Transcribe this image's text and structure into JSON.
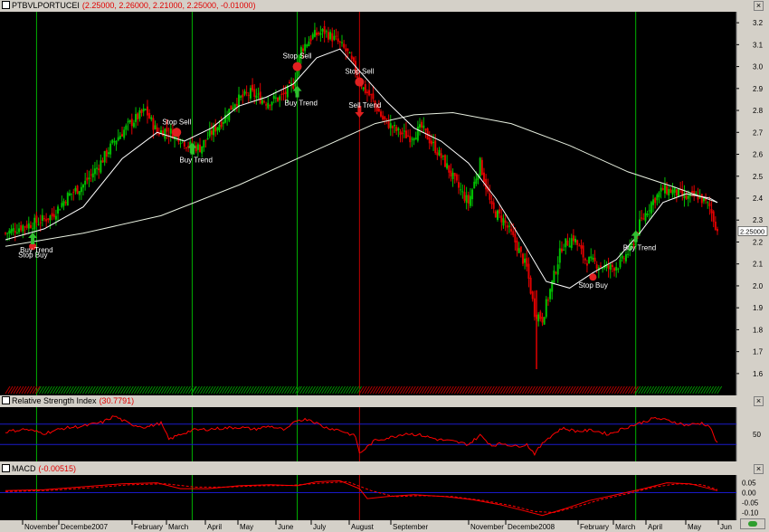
{
  "main_pane": {
    "symbol": "PTBVLPORTUCEI",
    "ohlc_text": "(2.25000, 2.26000, 2.21000, 2.25000, -0.01000)",
    "last_price_label": "2.25000",
    "y_ticks": [
      "3.2",
      "3.1",
      "3.0",
      "2.9",
      "2.8",
      "2.7",
      "2.6",
      "2.5",
      "2.4",
      "2.3",
      "2.2",
      "2.1",
      "2.0",
      "1.9",
      "1.8",
      "1.7",
      "1.6"
    ]
  },
  "rsi_pane": {
    "name": "Relative Strength Index",
    "value_text": "(30.7791)",
    "y_ticks": [
      "50"
    ]
  },
  "macd_pane": {
    "name": "MACD",
    "value_text": "(-0.00515)",
    "y_ticks": [
      "0.05",
      "0.00",
      "-0.05",
      "-0.10"
    ]
  },
  "x_axis_labels": [
    "November",
    "Decembe2007",
    "February",
    "March",
    "April",
    "May",
    "June",
    "July",
    "August",
    "September",
    "November",
    "Decembe2008",
    "February",
    "March",
    "April",
    "May",
    "Jun"
  ],
  "annotations": {
    "stop_buy": "Stop Buy",
    "buy_trend": "Buy Trend",
    "stop_sell": "Stop Sell",
    "sell_trend": "Sell Trend"
  },
  "colors": {
    "background": "#000000",
    "candle_up": "#00c000",
    "candle_down": "#e00000",
    "ma_fast": "#ffffff",
    "ma_slow": "#e8f0e0",
    "buy_line": "#00b000",
    "sell_line": "#c00000",
    "rsi_line": "#ff0000",
    "guide_line": "#1a1ac8"
  },
  "chart_data": [
    {
      "type": "candlestick",
      "title": "PTBVLPORTUCEI",
      "ylim": [
        1.55,
        3.25
      ],
      "y_ticks": [
        3.2,
        3.1,
        3.0,
        2.9,
        2.8,
        2.7,
        2.6,
        2.5,
        2.4,
        2.3,
        2.2,
        2.1,
        2.0,
        1.9,
        1.8,
        1.7,
        1.6
      ],
      "close_path": [
        [
          0,
          2.24
        ],
        [
          8,
          2.27
        ],
        [
          16,
          2.29
        ],
        [
          24,
          2.32
        ],
        [
          32,
          2.41
        ],
        [
          40,
          2.46
        ],
        [
          48,
          2.55
        ],
        [
          56,
          2.66
        ],
        [
          64,
          2.74
        ],
        [
          72,
          2.8
        ],
        [
          78,
          2.7
        ],
        [
          82,
          2.71
        ],
        [
          88,
          2.69
        ],
        [
          94,
          2.64
        ],
        [
          100,
          2.63
        ],
        [
          106,
          2.7
        ],
        [
          112,
          2.76
        ],
        [
          118,
          2.84
        ],
        [
          126,
          2.88
        ],
        [
          134,
          2.84
        ],
        [
          142,
          2.86
        ],
        [
          148,
          2.92
        ],
        [
          152,
          3.08
        ],
        [
          158,
          3.14
        ],
        [
          164,
          3.16
        ],
        [
          170,
          3.12
        ],
        [
          176,
          3.06
        ],
        [
          180,
          2.98
        ],
        [
          184,
          2.9
        ],
        [
          188,
          2.86
        ],
        [
          194,
          2.76
        ],
        [
          202,
          2.7
        ],
        [
          208,
          2.68
        ],
        [
          214,
          2.72
        ],
        [
          220,
          2.64
        ],
        [
          226,
          2.56
        ],
        [
          232,
          2.46
        ],
        [
          238,
          2.38
        ],
        [
          244,
          2.56
        ],
        [
          250,
          2.35
        ],
        [
          256,
          2.3
        ],
        [
          262,
          2.2
        ],
        [
          268,
          2.08
        ],
        [
          272,
          1.88
        ],
        [
          276,
          1.85
        ],
        [
          280,
          1.98
        ],
        [
          286,
          2.18
        ],
        [
          292,
          2.22
        ],
        [
          298,
          2.12
        ],
        [
          304,
          2.1
        ],
        [
          310,
          2.08
        ],
        [
          316,
          2.1
        ],
        [
          322,
          2.18
        ],
        [
          326,
          2.28
        ],
        [
          332,
          2.38
        ],
        [
          338,
          2.44
        ],
        [
          344,
          2.43
        ],
        [
          350,
          2.4
        ],
        [
          356,
          2.41
        ],
        [
          362,
          2.36
        ],
        [
          366,
          2.25
        ]
      ],
      "ma_fast_path": [
        [
          0,
          2.21
        ],
        [
          20,
          2.26
        ],
        [
          40,
          2.36
        ],
        [
          60,
          2.58
        ],
        [
          78,
          2.7
        ],
        [
          92,
          2.66
        ],
        [
          106,
          2.72
        ],
        [
          120,
          2.82
        ],
        [
          134,
          2.86
        ],
        [
          148,
          2.92
        ],
        [
          160,
          3.04
        ],
        [
          172,
          3.08
        ],
        [
          184,
          2.96
        ],
        [
          196,
          2.84
        ],
        [
          210,
          2.72
        ],
        [
          224,
          2.66
        ],
        [
          238,
          2.56
        ],
        [
          252,
          2.4
        ],
        [
          266,
          2.2
        ],
        [
          278,
          2.02
        ],
        [
          290,
          1.99
        ],
        [
          302,
          2.06
        ],
        [
          314,
          2.12
        ],
        [
          326,
          2.24
        ],
        [
          338,
          2.38
        ],
        [
          350,
          2.42
        ],
        [
          362,
          2.4
        ],
        [
          366,
          2.38
        ]
      ],
      "ma_slow_path": [
        [
          0,
          2.18
        ],
        [
          40,
          2.24
        ],
        [
          80,
          2.32
        ],
        [
          120,
          2.46
        ],
        [
          160,
          2.62
        ],
        [
          190,
          2.74
        ],
        [
          210,
          2.78
        ],
        [
          230,
          2.79
        ],
        [
          260,
          2.74
        ],
        [
          290,
          2.64
        ],
        [
          320,
          2.52
        ],
        [
          344,
          2.45
        ],
        [
          366,
          2.38
        ]
      ],
      "signals": [
        {
          "label": "Stop Buy",
          "x": 14,
          "price": 2.18
        },
        {
          "label": "Buy Trend",
          "x": 14,
          "price": 2.21
        },
        {
          "label": "Stop Sell",
          "x": 88,
          "price": 2.7
        },
        {
          "label": "Buy Trend",
          "x": 96,
          "price": 2.62
        },
        {
          "label": "Stop Sell",
          "x": 150,
          "price": 3.0
        },
        {
          "label": "Buy Trend",
          "x": 150,
          "price": 2.88
        },
        {
          "label": "Stop Sell",
          "x": 182,
          "price": 2.93
        },
        {
          "label": "Sell Trend",
          "x": 182,
          "price": 2.8
        },
        {
          "label": "Stop Buy",
          "x": 302,
          "price": 2.04
        },
        {
          "label": "Buy Trend",
          "x": 324,
          "price": 2.22
        }
      ],
      "buy_lines_x": [
        16,
        96,
        150,
        324
      ],
      "sell_lines_x": [
        182
      ]
    },
    {
      "type": "line",
      "title": "Relative Strength Index",
      "ylim": [
        0,
        100
      ],
      "guides": [
        70,
        30
      ],
      "value_path": [
        [
          0,
          55
        ],
        [
          10,
          60
        ],
        [
          20,
          52
        ],
        [
          30,
          62
        ],
        [
          40,
          66
        ],
        [
          50,
          74
        ],
        [
          56,
          86
        ],
        [
          64,
          70
        ],
        [
          72,
          64
        ],
        [
          80,
          72
        ],
        [
          84,
          40
        ],
        [
          90,
          50
        ],
        [
          96,
          58
        ],
        [
          104,
          60
        ],
        [
          112,
          62
        ],
        [
          120,
          64
        ],
        [
          128,
          60
        ],
        [
          136,
          66
        ],
        [
          144,
          58
        ],
        [
          150,
          78
        ],
        [
          156,
          80
        ],
        [
          164,
          64
        ],
        [
          172,
          58
        ],
        [
          180,
          46
        ],
        [
          182,
          12
        ],
        [
          190,
          38
        ],
        [
          198,
          44
        ],
        [
          206,
          52
        ],
        [
          214,
          48
        ],
        [
          222,
          40
        ],
        [
          230,
          36
        ],
        [
          238,
          30
        ],
        [
          244,
          48
        ],
        [
          250,
          28
        ],
        [
          256,
          32
        ],
        [
          262,
          26
        ],
        [
          268,
          30
        ],
        [
          272,
          12
        ],
        [
          278,
          40
        ],
        [
          286,
          62
        ],
        [
          294,
          56
        ],
        [
          302,
          58
        ],
        [
          310,
          50
        ],
        [
          318,
          62
        ],
        [
          326,
          72
        ],
        [
          334,
          82
        ],
        [
          342,
          76
        ],
        [
          350,
          68
        ],
        [
          358,
          72
        ],
        [
          362,
          66
        ],
        [
          366,
          31
        ]
      ]
    },
    {
      "type": "line",
      "title": "MACD",
      "ylim": [
        -0.13,
        0.08
      ],
      "guides": [
        0
      ],
      "macd_path": [
        [
          0,
          0.01
        ],
        [
          20,
          0.015
        ],
        [
          40,
          0.03
        ],
        [
          60,
          0.045
        ],
        [
          78,
          0.05
        ],
        [
          90,
          0.02
        ],
        [
          104,
          0.02
        ],
        [
          120,
          0.035
        ],
        [
          136,
          0.04
        ],
        [
          150,
          0.035
        ],
        [
          160,
          0.055
        ],
        [
          172,
          0.06
        ],
        [
          182,
          0.02
        ],
        [
          186,
          -0.03
        ],
        [
          196,
          -0.02
        ],
        [
          210,
          -0.01
        ],
        [
          226,
          -0.02
        ],
        [
          240,
          -0.035
        ],
        [
          254,
          -0.06
        ],
        [
          266,
          -0.09
        ],
        [
          276,
          -0.115
        ],
        [
          288,
          -0.08
        ],
        [
          300,
          -0.04
        ],
        [
          314,
          -0.01
        ],
        [
          328,
          0.02
        ],
        [
          340,
          0.05
        ],
        [
          352,
          0.045
        ],
        [
          366,
          0.01
        ]
      ],
      "signal_path": [
        [
          0,
          0.005
        ],
        [
          24,
          0.012
        ],
        [
          44,
          0.025
        ],
        [
          64,
          0.04
        ],
        [
          82,
          0.045
        ],
        [
          98,
          0.028
        ],
        [
          114,
          0.028
        ],
        [
          130,
          0.035
        ],
        [
          146,
          0.036
        ],
        [
          162,
          0.048
        ],
        [
          176,
          0.055
        ],
        [
          188,
          0.01
        ],
        [
          200,
          -0.02
        ],
        [
          214,
          -0.015
        ],
        [
          230,
          -0.02
        ],
        [
          246,
          -0.04
        ],
        [
          260,
          -0.065
        ],
        [
          272,
          -0.095
        ],
        [
          282,
          -0.1
        ],
        [
          294,
          -0.07
        ],
        [
          306,
          -0.035
        ],
        [
          320,
          -0.005
        ],
        [
          334,
          0.03
        ],
        [
          346,
          0.045
        ],
        [
          358,
          0.04
        ],
        [
          366,
          0.015
        ]
      ]
    }
  ]
}
